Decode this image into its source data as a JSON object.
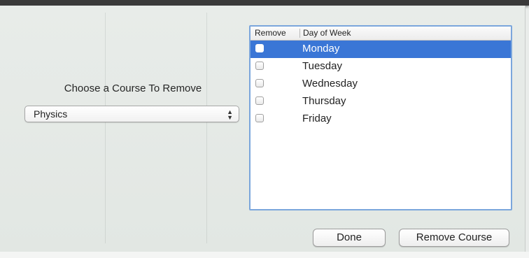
{
  "dialog": {
    "choose_label": "Choose a Course To Remove",
    "course_select": {
      "selected": "Physics"
    }
  },
  "days_table": {
    "headers": {
      "remove": "Remove",
      "day_of_week": "Day of Week"
    },
    "rows": [
      {
        "day": "Monday",
        "checked": false,
        "selected": true
      },
      {
        "day": "Tuesday",
        "checked": false,
        "selected": false
      },
      {
        "day": "Wednesday",
        "checked": false,
        "selected": false
      },
      {
        "day": "Thursday",
        "checked": false,
        "selected": false
      },
      {
        "day": "Friday",
        "checked": false,
        "selected": false
      }
    ]
  },
  "buttons": {
    "done": "Done",
    "remove_course": "Remove Course"
  },
  "colors": {
    "selection": "#3a76d6",
    "table_border": "#7ba6dc",
    "sheet_background": "#e6ebe7"
  }
}
